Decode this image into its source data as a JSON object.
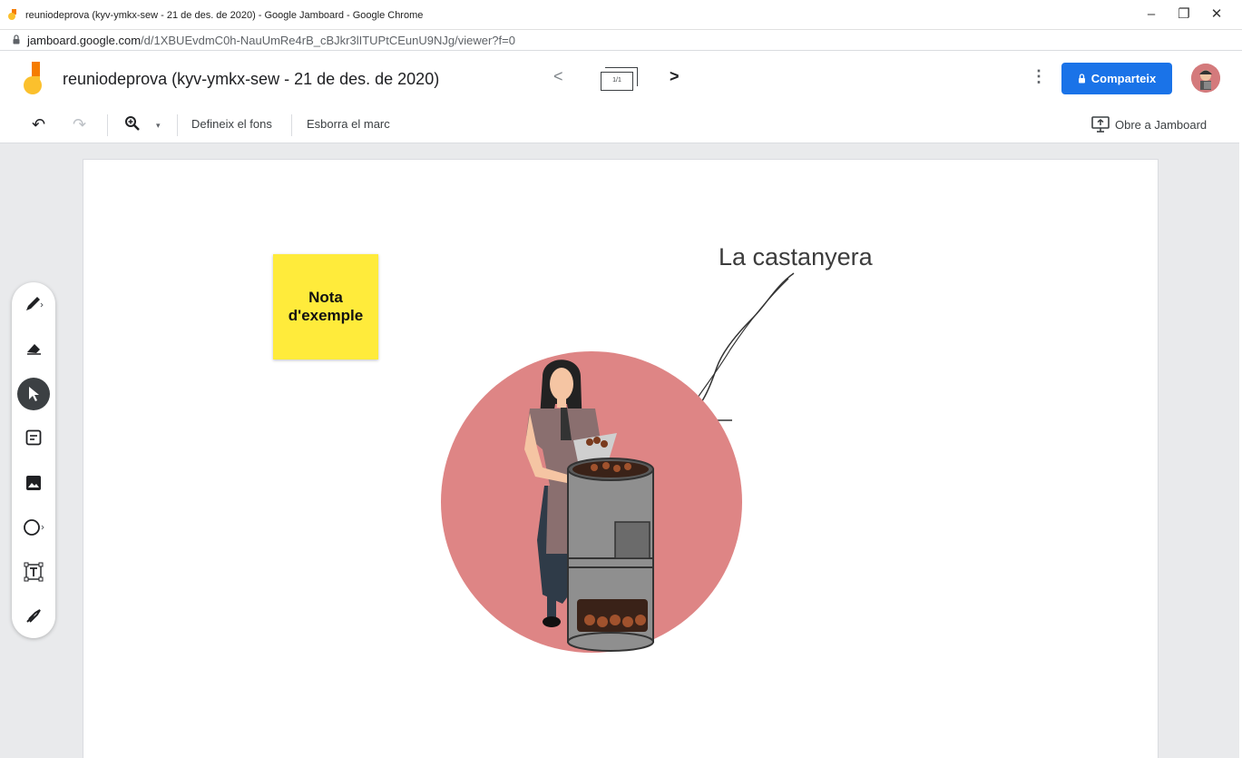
{
  "window": {
    "title": "reuniodeprova (kyv-ymkx-sew - 21 de des. de 2020) - Google Jamboard - Google Chrome",
    "minimize_icon": "minimize-icon",
    "restore_icon": "restore-icon",
    "close_icon": "close-icon"
  },
  "address_bar": {
    "host": "jamboard.google.com",
    "path": "/d/1XBUEvdmC0h-NauUmRe4rB_cBJkr3lITUPtCEunU9NJg/viewer?f=0"
  },
  "header": {
    "doc_title": "reuniodeprova (kyv-ymkx-sew - 21 de des. de 2020)",
    "frame_indicator": "1/1",
    "share_label": "Comparteix"
  },
  "toolbar": {
    "set_background": "Defineix el fons",
    "clear_frame": "Esborra el marc",
    "open_in_jamboard": "Obre a Jamboard"
  },
  "canvas": {
    "sticky_note": "Nota d'exemple",
    "caption": "La castanyera",
    "sticky_color": "#ffeb3b",
    "circle_color": "#de8585"
  },
  "palette": {
    "tools": [
      "pen-icon",
      "eraser-icon",
      "select-icon",
      "sticky-note-icon",
      "image-icon",
      "circle-icon",
      "text-box-icon",
      "laser-icon"
    ],
    "active_tool": "select-icon"
  },
  "colors": {
    "accent": "#1a73e8"
  }
}
